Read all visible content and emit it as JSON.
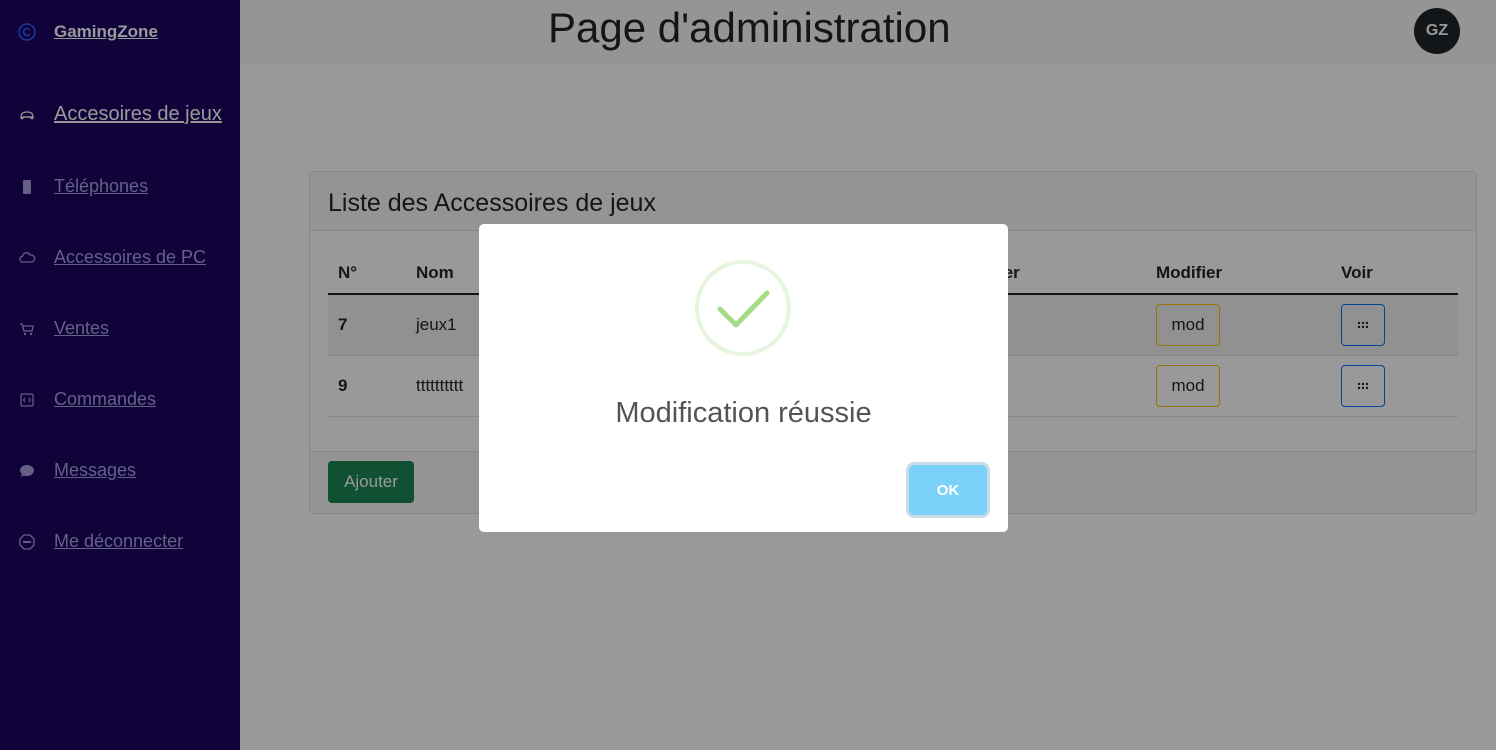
{
  "app": {
    "brand": "GamingZone",
    "avatar_initials": "GZ",
    "page_title": "Page d'administration"
  },
  "sidebar": {
    "items": [
      {
        "label": "Accesoires de jeux",
        "icon": "gamepad-icon",
        "active": true
      },
      {
        "label": "Téléphones",
        "icon": "phone-icon",
        "active": false
      },
      {
        "label": "Accessoires de PC",
        "icon": "cloud-icon",
        "active": false
      },
      {
        "label": "Ventes",
        "icon": "cart-icon",
        "active": false
      },
      {
        "label": "Commandes",
        "icon": "order-icon",
        "active": false
      },
      {
        "label": "Messages",
        "icon": "chat-icon",
        "active": false
      },
      {
        "label": "Me déconnecter",
        "icon": "stop-icon",
        "active": false
      }
    ]
  },
  "card": {
    "title": "Liste des Accessoires de jeux",
    "columns": {
      "no": "N°",
      "nom": "Nom",
      "hidden": "ier",
      "modifier": "Modifier",
      "voir": "Voir"
    },
    "rows": [
      {
        "no": "7",
        "nom": "jeux1",
        "mod_label": "mod"
      },
      {
        "no": "9",
        "nom": "tttttttttt",
        "mod_label": "mod"
      }
    ],
    "add_label": "Ajouter"
  },
  "modal": {
    "message": "Modification réussie",
    "ok_label": "OK"
  },
  "colors": {
    "sidebar": "#1a0661",
    "success": "#a5dc86",
    "ok_button": "#7cd1f9",
    "add_button": "#198754"
  }
}
